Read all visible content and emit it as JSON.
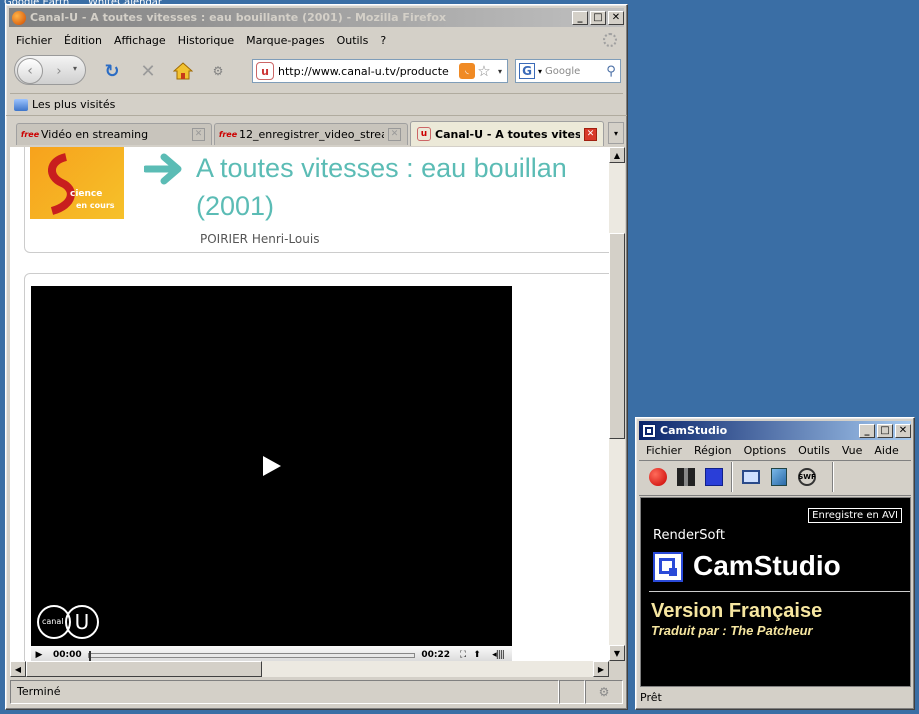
{
  "desktop": {
    "items": [
      "Google Earth",
      "WhiteCalendar"
    ]
  },
  "firefox": {
    "title": "Canal-U - A toutes vitesses : eau bouillante (2001) - Mozilla Firefox",
    "menu": [
      "Fichier",
      "Édition",
      "Affichage",
      "Historique",
      "Marque-pages",
      "Outils",
      "?"
    ],
    "url": "http://www.canal-u.tv/producte",
    "search_placeholder": "Google",
    "bookmark": "Les plus visités",
    "tabs": [
      {
        "label": "Vidéo en streaming",
        "icon": "free"
      },
      {
        "label": "12_enregistrer_video_strea...",
        "icon": "free"
      },
      {
        "label": "Canal-U - A toutes vites...",
        "icon": "u"
      }
    ],
    "page": {
      "logo_text_1": "cience",
      "logo_text_2": "en cours",
      "title_line1": "A toutes vitesses : eau bouillan",
      "title_line2": "(2001)",
      "author": "POIRIER Henri-Louis",
      "watermark": "canal",
      "time_current": "00:00",
      "time_total": "00:22"
    },
    "status": "Terminé",
    "colors": {
      "title_accent": "#5bbcb5"
    }
  },
  "camstudio": {
    "title": "CamStudio",
    "menu": [
      "Fichier",
      "Région",
      "Options",
      "Outils",
      "Vue",
      "Aide"
    ],
    "tooltip": "Enregistre en AVI",
    "brand": "RenderSoft",
    "product": "CamStudio",
    "version": "Version Française",
    "credit": "Traduit par : The Patcheur",
    "status": "Prêt",
    "tools": [
      "record-icon",
      "pause-icon",
      "stop-icon",
      "region-icon",
      "annotation-icon",
      "swf-icon"
    ]
  }
}
